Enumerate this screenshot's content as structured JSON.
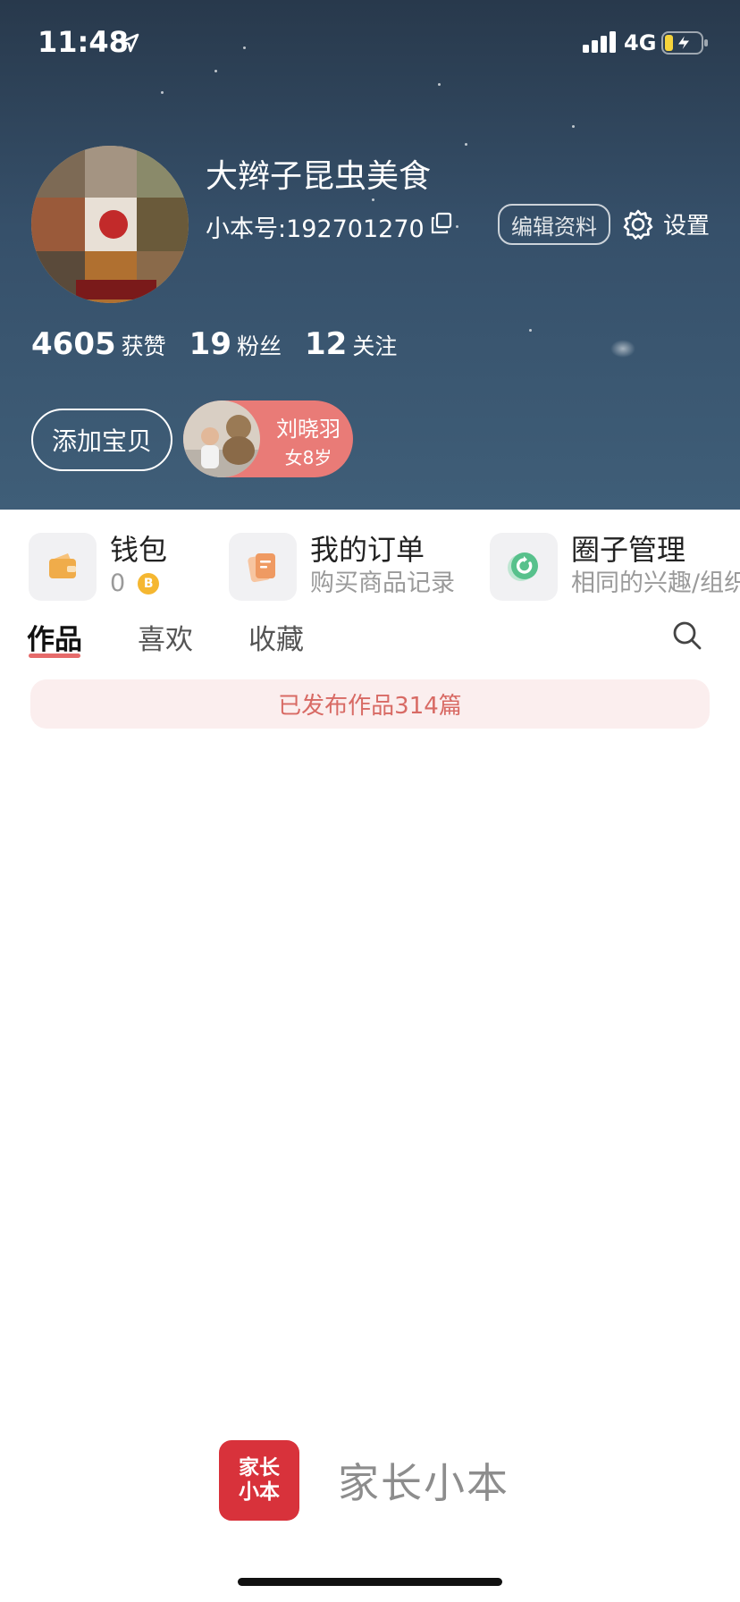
{
  "status_bar": {
    "time": "11:48",
    "network": "4G"
  },
  "profile": {
    "name": "大辫子昆虫美食",
    "id_text": "小本号:192701270",
    "edit_label": "编辑资料",
    "settings_label": "设置"
  },
  "stats": [
    {
      "value": "4605",
      "label": "获赞"
    },
    {
      "value": "19",
      "label": "粉丝"
    },
    {
      "value": "12",
      "label": "关注"
    }
  ],
  "baby": {
    "add_label": "添加宝贝",
    "child_name": "刘晓羽",
    "child_info": "女8岁"
  },
  "quick_links": {
    "wallet": {
      "title": "钱包",
      "balance": "0",
      "coin_symbol": "B"
    },
    "orders": {
      "title": "我的订单",
      "subtitle": "购买商品记录"
    },
    "circles": {
      "title": "圈子管理",
      "subtitle": "相同的兴趣/组织"
    }
  },
  "tabs": [
    {
      "label": "作品",
      "active": true
    },
    {
      "label": "喜欢",
      "active": false
    },
    {
      "label": "收藏",
      "active": false
    }
  ],
  "banner": {
    "text": "已发布作品314篇"
  },
  "brand": {
    "logo_line1": "家长",
    "logo_line2": "小本",
    "name": "家长小本"
  },
  "colors": {
    "header_bg": "#36506a",
    "accent_red": "#e66a6a",
    "child_card": "#e97b77",
    "brand_red": "#d8323b"
  }
}
